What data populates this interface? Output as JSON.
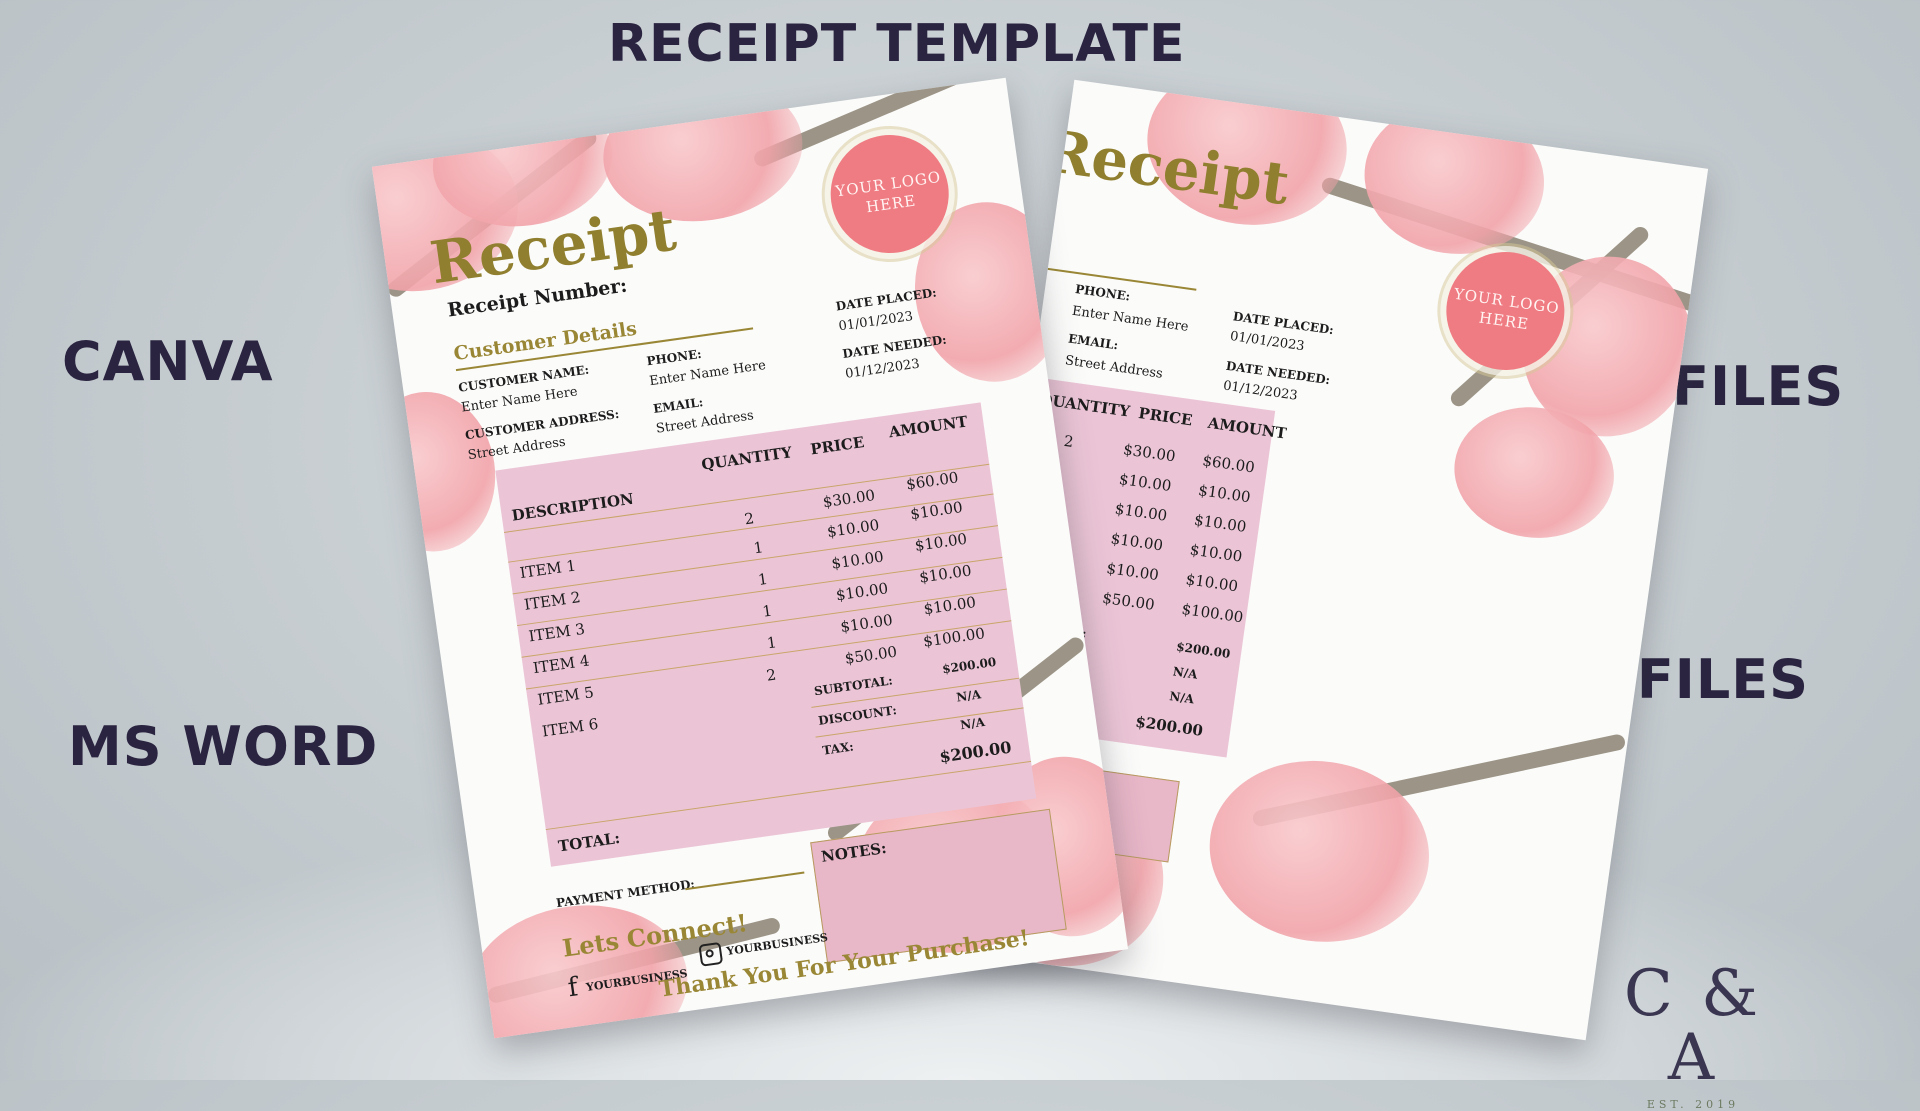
{
  "headings": {
    "title": "RECEIPT TEMPLATE",
    "canva": "CANVA",
    "ms_word": "MS WORD",
    "pdf_files": "PDF FILES",
    "png_files": "PNG FILES"
  },
  "brand": {
    "mark": "C & A",
    "est": "EST. 2019"
  },
  "receipt": {
    "title": "Receipt",
    "receipt_number_label": "Receipt Number:",
    "logo_text": "YOUR LOGO HERE",
    "customer_details": "Customer Details",
    "customer_name_label": "CUSTOMER NAME:",
    "customer_name_value": "Enter Name Here",
    "customer_address_label": "CUSTOMER ADDRESS:",
    "customer_address_value": "Street Address",
    "phone_label": "PHONE:",
    "phone_value": "Enter Name Here",
    "email_label": "EMAIL:",
    "email_value": "Street Address",
    "date_placed_label": "DATE PLACED:",
    "date_placed_value": "01/01/2023",
    "date_needed_label": "DATE NEEDED:",
    "date_needed_value": "01/12/2023",
    "columns": {
      "description": "DESCRIPTION",
      "quantity": "QUANTITY",
      "price": "PRICE",
      "amount": "AMOUNT"
    },
    "items": [
      {
        "description": "ITEM 1",
        "quantity": "2",
        "price": "$30.00",
        "amount": "$60.00"
      },
      {
        "description": "ITEM 2",
        "quantity": "1",
        "price": "$10.00",
        "amount": "$10.00"
      },
      {
        "description": "ITEM 3",
        "quantity": "1",
        "price": "$10.00",
        "amount": "$10.00"
      },
      {
        "description": "ITEM 4",
        "quantity": "1",
        "price": "$10.00",
        "amount": "$10.00"
      },
      {
        "description": "ITEM 5",
        "quantity": "1",
        "price": "$10.00",
        "amount": "$10.00"
      },
      {
        "description": "ITEM 6",
        "quantity": "2",
        "price": "$50.00",
        "amount": "$100.00"
      }
    ],
    "subtotal_label": "SUBTOTAL:",
    "subtotal_value": "$200.00",
    "discount_label": "DISCOUNT:",
    "discount_value": "N/A",
    "tax_label": "TAX:",
    "tax_value": "N/A",
    "grand_value": "$200.00",
    "total_label": "TOTAL:",
    "notes_label": "NOTES:",
    "payment_method_label": "PAYMENT METHOD:",
    "lets_connect": "Lets Connect!",
    "facebook_handle": "YOURBUSINESS",
    "instagram_handle": "YOURBUSINESS",
    "thank_you": "Thank You For Your Purchase!"
  },
  "colors": {
    "heading": "#2a2440",
    "gold": "#9a8736",
    "table_pink": "#ebc5d6",
    "logo_coral": "#f07c83",
    "blossom": "#f1a3a9"
  }
}
